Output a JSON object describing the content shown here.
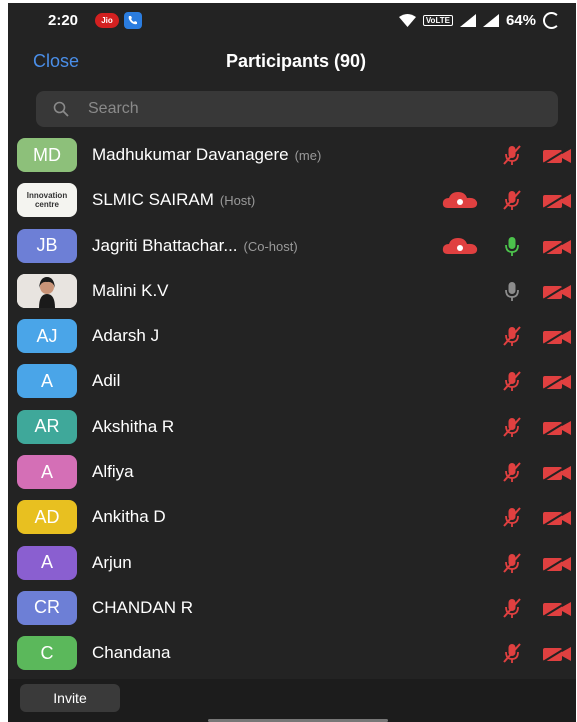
{
  "status": {
    "time": "2:20",
    "carrier_badge": "Jio",
    "network_badge": "VoLTE",
    "battery": "64%"
  },
  "header": {
    "close_label": "Close",
    "title": "Participants (90)"
  },
  "search": {
    "placeholder": "Search"
  },
  "participants": [
    {
      "initials": "MD",
      "name": "Madhukumar Davanagere",
      "role": "(me)",
      "avatar_color": "#8dc07a",
      "cloud": false,
      "mic": "muted",
      "video": "off"
    },
    {
      "initials": "",
      "name": "SLMIC SAIRAM",
      "role": "(Host)",
      "avatar_type": "logo",
      "logo_text": "Innovation centre",
      "cloud": true,
      "mic": "muted",
      "video": "off"
    },
    {
      "initials": "JB",
      "name": "Jagriti Bhattachar...",
      "role": "(Co-host)",
      "avatar_color": "#6d7fd6",
      "cloud": true,
      "mic": "on",
      "video": "off"
    },
    {
      "initials": "",
      "name": "Malini K.V",
      "role": "",
      "avatar_type": "photo",
      "cloud": false,
      "mic": "idle",
      "video": "off"
    },
    {
      "initials": "AJ",
      "name": "Adarsh J",
      "role": "",
      "avatar_color": "#4aa5e8",
      "cloud": false,
      "mic": "muted",
      "video": "off"
    },
    {
      "initials": "A",
      "name": "Adil",
      "role": "",
      "avatar_color": "#4aa5e8",
      "cloud": false,
      "mic": "muted",
      "video": "off"
    },
    {
      "initials": "AR",
      "name": "Akshitha R",
      "role": "",
      "avatar_color": "#3fa89a",
      "cloud": false,
      "mic": "muted",
      "video": "off"
    },
    {
      "initials": "A",
      "name": "Alfiya",
      "role": "",
      "avatar_color": "#d46fb6",
      "cloud": false,
      "mic": "muted",
      "video": "off"
    },
    {
      "initials": "AD",
      "name": "Ankitha D",
      "role": "",
      "avatar_color": "#e8c020",
      "cloud": false,
      "mic": "muted",
      "video": "off"
    },
    {
      "initials": "A",
      "name": "Arjun",
      "role": "",
      "avatar_color": "#8a5fd0",
      "cloud": false,
      "mic": "muted",
      "video": "off"
    },
    {
      "initials": "CR",
      "name": "CHANDAN R",
      "role": "",
      "avatar_color": "#6d7fd6",
      "cloud": false,
      "mic": "muted",
      "video": "off"
    },
    {
      "initials": "C",
      "name": "Chandana",
      "role": "",
      "avatar_color": "#5bb85b",
      "cloud": false,
      "mic": "muted",
      "video": "off"
    }
  ],
  "footer": {
    "invite_label": "Invite"
  },
  "colors": {
    "accent": "#4a8ee8",
    "muted_red": "#e04040",
    "mic_on_green": "#4cc34c",
    "background": "#232323"
  }
}
